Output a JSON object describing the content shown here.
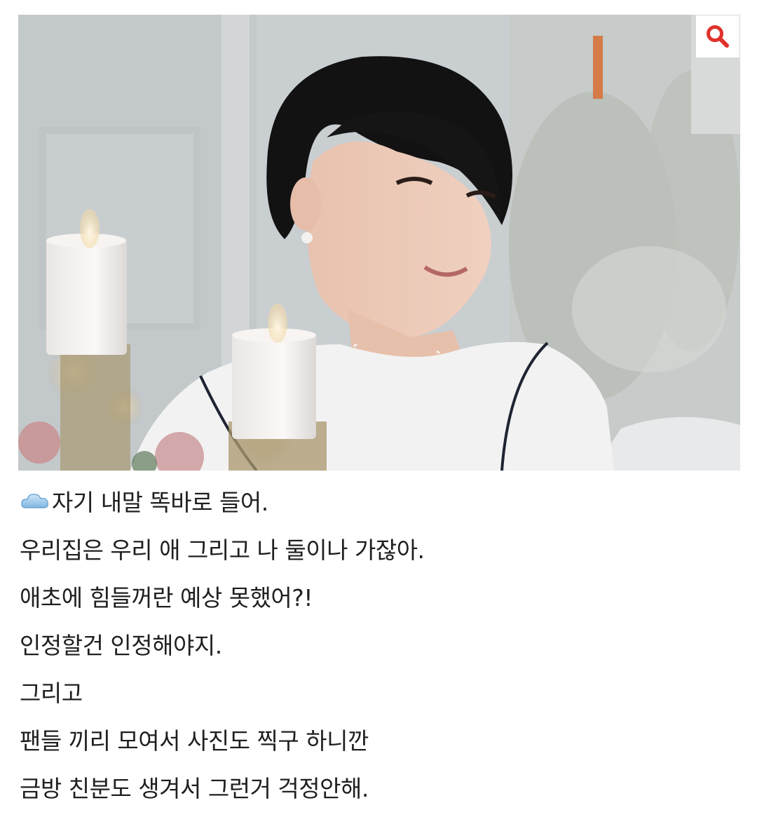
{
  "photo": {
    "zoom_icon": "search-icon",
    "zoom_color": "#e0312b"
  },
  "caption": {
    "emoji_icon": "cloud-icon",
    "lines": [
      "자기 내말 똑바로 들어.",
      "우리집은 우리 애 그리고 나 둘이나 가잖아.",
      "애초에 힘들꺼란 예상 못했어?!",
      "인정할건 인정해야지.",
      "그리고",
      "팬들 끼리 모여서 사진도 찍구 하니깐",
      "금방 친분도 생겨서 그런거 걱정안해."
    ]
  }
}
